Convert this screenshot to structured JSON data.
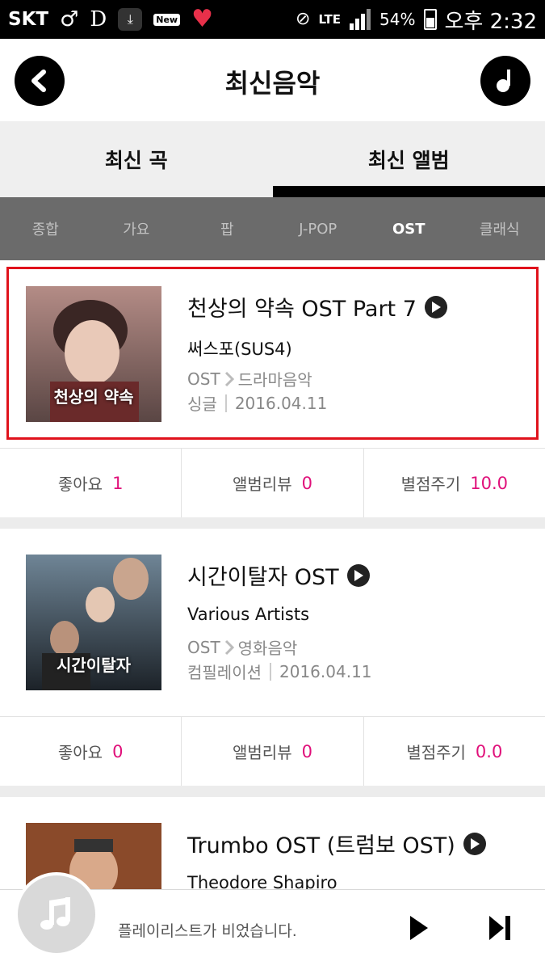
{
  "status_bar": {
    "carrier": "SKT",
    "icons": [
      "male-symbol-icon",
      "d-icon",
      "download-icon",
      "wifi-new-icon",
      "heart-icon",
      "mute-icon",
      "lte-icon",
      "signal-icon",
      "battery-icon"
    ],
    "new_badge": "New",
    "lte": "LTE",
    "battery": "54%",
    "time": "오후 2:32"
  },
  "header": {
    "title": "최신음악",
    "back_icon": "chevron-left-icon",
    "music_icon": "music-note-icon"
  },
  "main_tabs": [
    {
      "label": "최신 곡",
      "active": false
    },
    {
      "label": "최신 앨범",
      "active": true
    }
  ],
  "sub_tabs": [
    {
      "label": "종합"
    },
    {
      "label": "가요"
    },
    {
      "label": "팝"
    },
    {
      "label": "J-POP"
    },
    {
      "label": "OST",
      "active": true
    },
    {
      "label": "클래식"
    }
  ],
  "albums": [
    {
      "title": "천상의 약속 OST Part 7",
      "artist": "써스포(SUS4)",
      "genre_main": "OST",
      "genre_sub": "드라마음악",
      "type": "싱글",
      "date": "2016.04.11",
      "cover_text": "천상의 약속",
      "cover_color": "#8a6a6a",
      "highlighted": true,
      "likes_label": "좋아요",
      "likes": "1",
      "review_label": "앨범리뷰",
      "reviews": "0",
      "rating_label": "별점주기",
      "rating": "10.0"
    },
    {
      "title": "시간이탈자 OST",
      "artist": "Various Artists",
      "genre_main": "OST",
      "genre_sub": "영화음악",
      "type": "컴필레이션",
      "date": "2016.04.11",
      "cover_text": "시간이탈자",
      "cover_color": "#3a4a5a",
      "highlighted": false,
      "likes_label": "좋아요",
      "likes": "0",
      "review_label": "앨범리뷰",
      "reviews": "0",
      "rating_label": "별점주기",
      "rating": "0.0"
    },
    {
      "title": "Trumbo OST (트럼보 OST)",
      "artist": "Theodore Shapiro",
      "cover_color": "#8a4a2a"
    }
  ],
  "player": {
    "message": "플레이리스트가 비었습니다.",
    "icons": [
      "music-note-icon",
      "play-icon",
      "skip-next-icon"
    ]
  },
  "colors": {
    "accent": "#e0107a",
    "highlight_border": "#e0121c",
    "subtab_bg": "#6b6b6b"
  }
}
